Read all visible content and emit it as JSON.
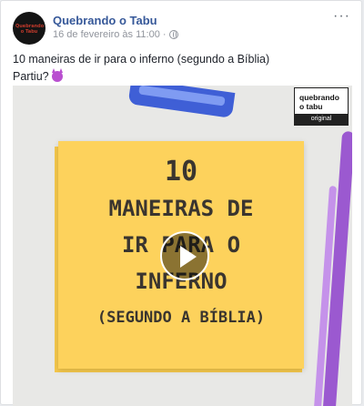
{
  "post": {
    "page_name": "Quebrando o Tabu",
    "avatar_text": "Quebrando o Tabu",
    "timestamp": "16 de fevereiro às 11:00",
    "timestamp_separator": "·",
    "more_label": "···",
    "caption_line1": "10 maneiras de ir para o inferno (segundo a Bíblia)",
    "caption_line2": "Partiu?",
    "caption_emoji": "devil-emoji"
  },
  "video": {
    "logo_line1": "quebrando",
    "logo_line2": "o tabu",
    "logo_badge": "original",
    "note_lines": [
      "10",
      "MANEIRAS DE",
      "IR PARA O",
      "INFERNO",
      "(SEGUNDO A BÍBLIA)"
    ],
    "play_icon": "play-icon"
  },
  "colors": {
    "link": "#365899",
    "meta": "#90949c",
    "sticky_note": "#fdd25c"
  }
}
